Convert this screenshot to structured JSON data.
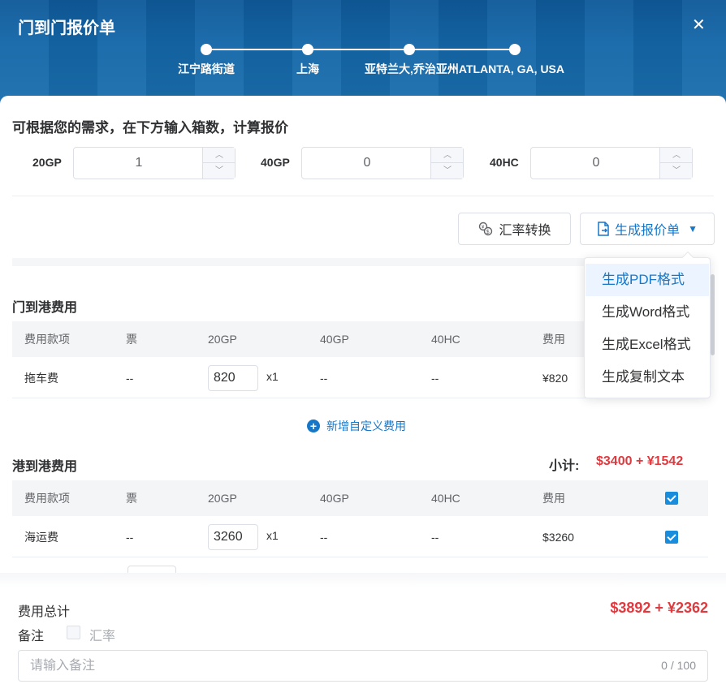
{
  "header": {
    "title": "门到门报价单",
    "close_icon": "close-icon",
    "route": [
      {
        "label": "江宁路街道"
      },
      {
        "label": "上海"
      },
      {
        "label": "亚特兰大,乔治亚州ATLANTA, GA, USA"
      },
      {
        "label": ""
      }
    ]
  },
  "intro": "可根据您的需求，在下方输入箱数，计算报价",
  "containers": [
    {
      "label": "20GP",
      "value": "1"
    },
    {
      "label": "40GP",
      "value": "0"
    },
    {
      "label": "40HC",
      "value": "0"
    }
  ],
  "toolbar": {
    "rate_label": "汇率转换",
    "rate_icon": "currency-exchange-icon",
    "generate_label": "生成报价单",
    "generate_icon": "document-export-icon",
    "caret_icon": "caret-down-icon"
  },
  "dropdown": {
    "items": [
      {
        "label": "生成PDF格式"
      },
      {
        "label": "生成Word格式"
      },
      {
        "label": "生成Excel格式"
      },
      {
        "label": "生成复制文本"
      }
    ],
    "active_index": 0
  },
  "columns": [
    "费用款项",
    "票",
    "20GP",
    "40GP",
    "40HC",
    "费用"
  ],
  "door_to_port": {
    "title": "门到港费用",
    "rows": [
      {
        "name": "拖车费",
        "ticket": "--",
        "amount": "820",
        "qty": "x1",
        "gp40": "--",
        "hc40": "--",
        "fee": "¥820"
      }
    ],
    "add_label": "新增自定义费用"
  },
  "port_to_port": {
    "title": "港到港费用",
    "subtotal_label": "小计:",
    "subtotal_value": "$3400 + ¥1542",
    "rows": [
      {
        "name": "海运费",
        "ticket": "--",
        "amount": "3260",
        "qty": "x1",
        "gp40": "--",
        "hc40": "--",
        "fee": "$3260"
      }
    ]
  },
  "footer": {
    "total_label": "费用总计",
    "total_value": "$3892 + ¥2362",
    "remark_label": "备注",
    "rate_label": "汇率",
    "remark_placeholder": "请输入备注",
    "remark_count": "0 / 100"
  },
  "colors": {
    "accent": "#1677c8",
    "total_red": "#e0393e",
    "header_blue": "#1466a8"
  }
}
